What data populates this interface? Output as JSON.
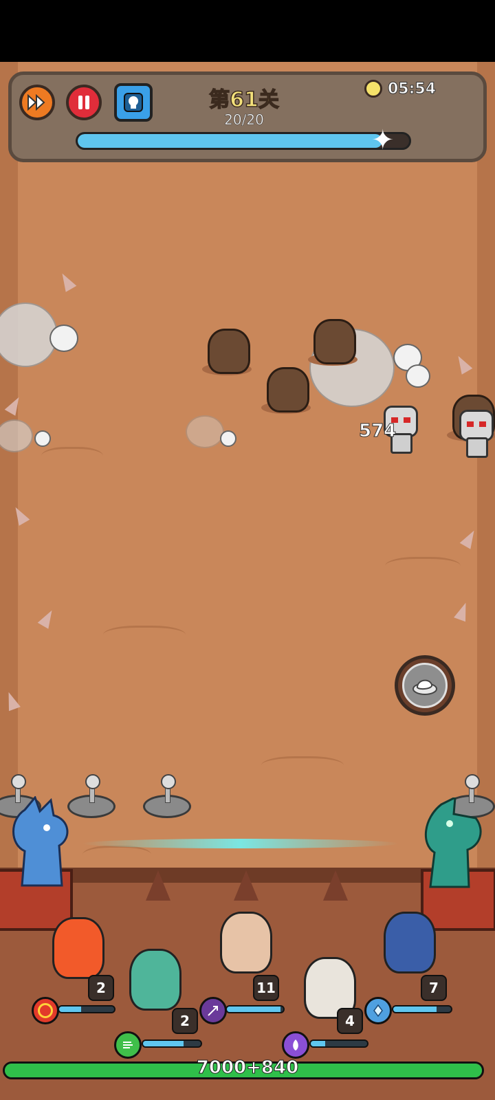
{
  "hud": {
    "level_title": "第61关",
    "wave": "20/20",
    "timer": "05:54",
    "wave_progress": 0.92,
    "accent_color": "#5fc6ef"
  },
  "combat": {
    "damage_popup": "574"
  },
  "heroes": [
    {
      "name": "fire-kid",
      "level": "2",
      "element_icon": "fire-ring-icon"
    },
    {
      "name": "antler-frog",
      "level": "2",
      "element_icon": "wind-icon"
    },
    {
      "name": "elf-mage",
      "level": "11",
      "element_icon": "arrow-icon"
    },
    {
      "name": "old-wizard",
      "level": "4",
      "element_icon": "feather-icon"
    },
    {
      "name": "ice-knight",
      "level": "7",
      "element_icon": "crystal-icon"
    }
  ],
  "base": {
    "hp_text": "7000+840",
    "hp_color": "#2fbf4a"
  }
}
